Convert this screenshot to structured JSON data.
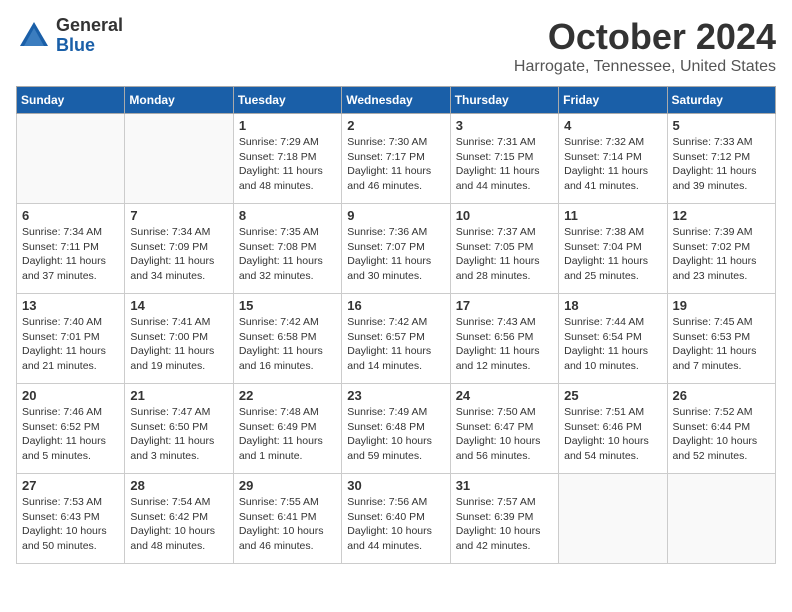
{
  "logo": {
    "general": "General",
    "blue": "Blue"
  },
  "title": "October 2024",
  "location": "Harrogate, Tennessee, United States",
  "weekdays": [
    "Sunday",
    "Monday",
    "Tuesday",
    "Wednesday",
    "Thursday",
    "Friday",
    "Saturday"
  ],
  "weeks": [
    [
      {
        "day": "",
        "info": ""
      },
      {
        "day": "",
        "info": ""
      },
      {
        "day": "1",
        "info": "Sunrise: 7:29 AM\nSunset: 7:18 PM\nDaylight: 11 hours and 48 minutes."
      },
      {
        "day": "2",
        "info": "Sunrise: 7:30 AM\nSunset: 7:17 PM\nDaylight: 11 hours and 46 minutes."
      },
      {
        "day": "3",
        "info": "Sunrise: 7:31 AM\nSunset: 7:15 PM\nDaylight: 11 hours and 44 minutes."
      },
      {
        "day": "4",
        "info": "Sunrise: 7:32 AM\nSunset: 7:14 PM\nDaylight: 11 hours and 41 minutes."
      },
      {
        "day": "5",
        "info": "Sunrise: 7:33 AM\nSunset: 7:12 PM\nDaylight: 11 hours and 39 minutes."
      }
    ],
    [
      {
        "day": "6",
        "info": "Sunrise: 7:34 AM\nSunset: 7:11 PM\nDaylight: 11 hours and 37 minutes."
      },
      {
        "day": "7",
        "info": "Sunrise: 7:34 AM\nSunset: 7:09 PM\nDaylight: 11 hours and 34 minutes."
      },
      {
        "day": "8",
        "info": "Sunrise: 7:35 AM\nSunset: 7:08 PM\nDaylight: 11 hours and 32 minutes."
      },
      {
        "day": "9",
        "info": "Sunrise: 7:36 AM\nSunset: 7:07 PM\nDaylight: 11 hours and 30 minutes."
      },
      {
        "day": "10",
        "info": "Sunrise: 7:37 AM\nSunset: 7:05 PM\nDaylight: 11 hours and 28 minutes."
      },
      {
        "day": "11",
        "info": "Sunrise: 7:38 AM\nSunset: 7:04 PM\nDaylight: 11 hours and 25 minutes."
      },
      {
        "day": "12",
        "info": "Sunrise: 7:39 AM\nSunset: 7:02 PM\nDaylight: 11 hours and 23 minutes."
      }
    ],
    [
      {
        "day": "13",
        "info": "Sunrise: 7:40 AM\nSunset: 7:01 PM\nDaylight: 11 hours and 21 minutes."
      },
      {
        "day": "14",
        "info": "Sunrise: 7:41 AM\nSunset: 7:00 PM\nDaylight: 11 hours and 19 minutes."
      },
      {
        "day": "15",
        "info": "Sunrise: 7:42 AM\nSunset: 6:58 PM\nDaylight: 11 hours and 16 minutes."
      },
      {
        "day": "16",
        "info": "Sunrise: 7:42 AM\nSunset: 6:57 PM\nDaylight: 11 hours and 14 minutes."
      },
      {
        "day": "17",
        "info": "Sunrise: 7:43 AM\nSunset: 6:56 PM\nDaylight: 11 hours and 12 minutes."
      },
      {
        "day": "18",
        "info": "Sunrise: 7:44 AM\nSunset: 6:54 PM\nDaylight: 11 hours and 10 minutes."
      },
      {
        "day": "19",
        "info": "Sunrise: 7:45 AM\nSunset: 6:53 PM\nDaylight: 11 hours and 7 minutes."
      }
    ],
    [
      {
        "day": "20",
        "info": "Sunrise: 7:46 AM\nSunset: 6:52 PM\nDaylight: 11 hours and 5 minutes."
      },
      {
        "day": "21",
        "info": "Sunrise: 7:47 AM\nSunset: 6:50 PM\nDaylight: 11 hours and 3 minutes."
      },
      {
        "day": "22",
        "info": "Sunrise: 7:48 AM\nSunset: 6:49 PM\nDaylight: 11 hours and 1 minute."
      },
      {
        "day": "23",
        "info": "Sunrise: 7:49 AM\nSunset: 6:48 PM\nDaylight: 10 hours and 59 minutes."
      },
      {
        "day": "24",
        "info": "Sunrise: 7:50 AM\nSunset: 6:47 PM\nDaylight: 10 hours and 56 minutes."
      },
      {
        "day": "25",
        "info": "Sunrise: 7:51 AM\nSunset: 6:46 PM\nDaylight: 10 hours and 54 minutes."
      },
      {
        "day": "26",
        "info": "Sunrise: 7:52 AM\nSunset: 6:44 PM\nDaylight: 10 hours and 52 minutes."
      }
    ],
    [
      {
        "day": "27",
        "info": "Sunrise: 7:53 AM\nSunset: 6:43 PM\nDaylight: 10 hours and 50 minutes."
      },
      {
        "day": "28",
        "info": "Sunrise: 7:54 AM\nSunset: 6:42 PM\nDaylight: 10 hours and 48 minutes."
      },
      {
        "day": "29",
        "info": "Sunrise: 7:55 AM\nSunset: 6:41 PM\nDaylight: 10 hours and 46 minutes."
      },
      {
        "day": "30",
        "info": "Sunrise: 7:56 AM\nSunset: 6:40 PM\nDaylight: 10 hours and 44 minutes."
      },
      {
        "day": "31",
        "info": "Sunrise: 7:57 AM\nSunset: 6:39 PM\nDaylight: 10 hours and 42 minutes."
      },
      {
        "day": "",
        "info": ""
      },
      {
        "day": "",
        "info": ""
      }
    ]
  ]
}
